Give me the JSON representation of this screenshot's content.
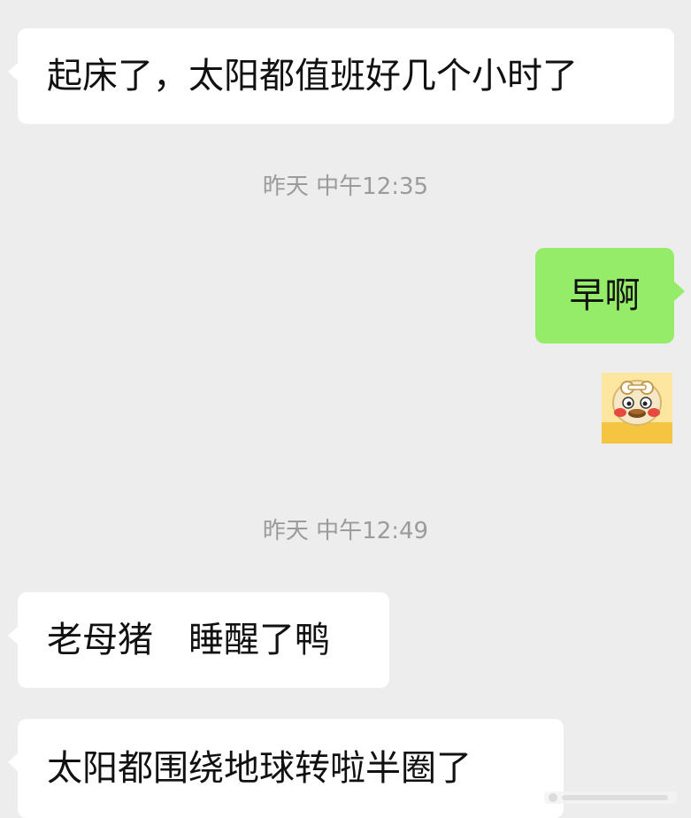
{
  "messages": {
    "m1": {
      "text": "起床了，太阳都值班好几个小时了",
      "side": "incoming"
    },
    "m2": {
      "text": "早啊",
      "side": "outgoing"
    },
    "m3": {
      "text": "老母猪　睡醒了鸭",
      "side": "incoming"
    },
    "m4": {
      "text": "太阳都围绕地球转啦半圈了",
      "side": "incoming"
    }
  },
  "timestamps": {
    "t1": "昨天 中午12:35",
    "t2": "昨天 中午12:49"
  },
  "sticker": {
    "icon": "duck-emoji-sticker-icon"
  },
  "colors": {
    "background": "#ededed",
    "incoming_bubble": "#ffffff",
    "outgoing_bubble": "#95ec69",
    "timestamp_text": "#9b9b9b"
  }
}
